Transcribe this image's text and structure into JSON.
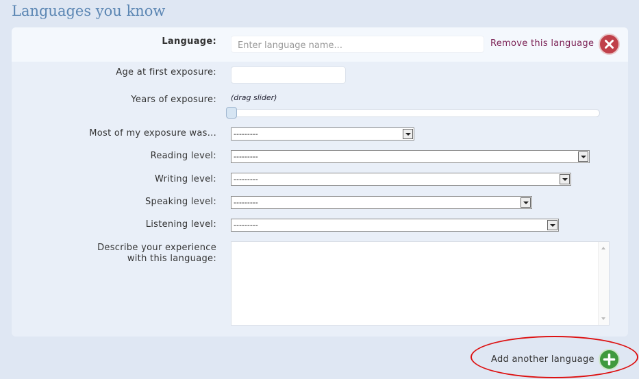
{
  "heading": "Languages you know",
  "form": {
    "language_label": "Language:",
    "language_placeholder": "Enter language name...",
    "remove_label": "Remove this language",
    "age_label": "Age at first exposure:",
    "age_value": "",
    "years_label": "Years of exposure:",
    "years_hint": "(drag slider)",
    "years_slider_fraction": 0,
    "exposure_label": "Most of my exposure was...",
    "exposure_value": "---------",
    "reading_label": "Reading level:",
    "reading_value": "---------",
    "writing_label": "Writing level:",
    "writing_value": "---------",
    "speaking_label": "Speaking level:",
    "speaking_value": "---------",
    "listening_label": "Listening level:",
    "listening_value": "---------",
    "describe_label_line1": "Describe your experience",
    "describe_label_line2": "with this language:",
    "describe_value": ""
  },
  "footer": {
    "add_label": "Add another language"
  },
  "icons": {
    "remove": "close-circle-icon",
    "add": "plus-circle-icon"
  },
  "colors": {
    "heading": "#5b86b3",
    "remove_link": "#7b2154",
    "remove_icon": "#c0404a",
    "add_icon": "#3f9a3d",
    "annotation": "#dd1111"
  }
}
